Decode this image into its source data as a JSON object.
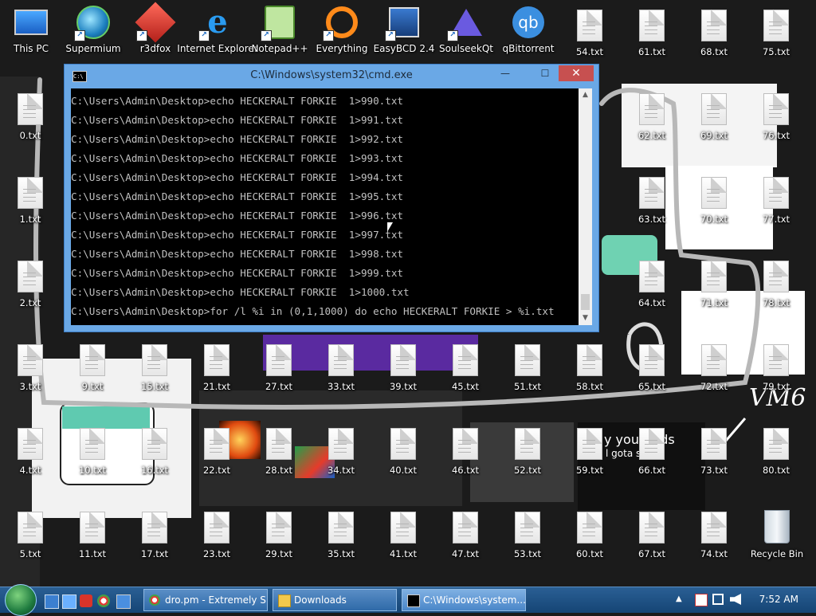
{
  "desktop": {
    "app_icons": [
      {
        "label": "This PC",
        "icon": "monitor-icon"
      },
      {
        "label": "Supermium",
        "icon": "globe-icon"
      },
      {
        "label": "r3dfox",
        "icon": "fox-icon"
      },
      {
        "label": "Internet Explorer",
        "icon": "ie-icon"
      },
      {
        "label": "Notepad++",
        "icon": "notepad-icon"
      },
      {
        "label": "Everything",
        "icon": "search-ring-icon"
      },
      {
        "label": "EasyBCD 2.4",
        "icon": "bcd-icon"
      },
      {
        "label": "SoulseekQt",
        "icon": "bird-icon"
      },
      {
        "label": "qBittorrent",
        "icon": "qb-icon"
      }
    ],
    "txt_files": [
      "0.txt",
      "1.txt",
      "2.txt",
      "3.txt",
      "4.txt",
      "5.txt",
      "9.txt",
      "10.txt",
      "11.txt",
      "15.txt",
      "16.txt",
      "17.txt",
      "21.txt",
      "22.txt",
      "23.txt",
      "27.txt",
      "28.txt",
      "29.txt",
      "33.txt",
      "34.txt",
      "35.txt",
      "39.txt",
      "40.txt",
      "41.txt",
      "45.txt",
      "46.txt",
      "47.txt",
      "51.txt",
      "52.txt",
      "53.txt",
      "54.txt",
      "58.txt",
      "59.txt",
      "60.txt",
      "61.txt",
      "62.txt",
      "63.txt",
      "64.txt",
      "65.txt",
      "66.txt",
      "67.txt",
      "68.txt",
      "69.txt",
      "70.txt",
      "71.txt",
      "72.txt",
      "73.txt",
      "74.txt",
      "75.txt",
      "76.txt",
      "77.txt",
      "78.txt",
      "79.txt",
      "80.txt"
    ],
    "recycle_bin": "Recycle Bin",
    "wallpaper_text": {
      "vm6": "VM6",
      "banner": "y you, ards",
      "subtitle": "l gota sup"
    }
  },
  "cmd_window": {
    "title": "C:\\Windows\\system32\\cmd.exe",
    "app_icon_text": "C:\\",
    "minimize": "—",
    "maximize": "☐",
    "close": "✕",
    "lines": [
      "C:\\Users\\Admin\\Desktop>echo HECKERALT FORKIE  1>990.txt",
      "C:\\Users\\Admin\\Desktop>echo HECKERALT FORKIE  1>991.txt",
      "C:\\Users\\Admin\\Desktop>echo HECKERALT FORKIE  1>992.txt",
      "C:\\Users\\Admin\\Desktop>echo HECKERALT FORKIE  1>993.txt",
      "C:\\Users\\Admin\\Desktop>echo HECKERALT FORKIE  1>994.txt",
      "C:\\Users\\Admin\\Desktop>echo HECKERALT FORKIE  1>995.txt",
      "C:\\Users\\Admin\\Desktop>echo HECKERALT FORKIE  1>996.txt",
      "C:\\Users\\Admin\\Desktop>echo HECKERALT FORKIE  1>997.txt",
      "C:\\Users\\Admin\\Desktop>echo HECKERALT FORKIE  1>998.txt",
      "C:\\Users\\Admin\\Desktop>echo HECKERALT FORKIE  1>999.txt",
      "C:\\Users\\Admin\\Desktop>echo HECKERALT FORKIE  1>1000.txt",
      "C:\\Users\\Admin\\Desktop>for /l %i in (0,1,1000) do echo HECKERALT FORKIE > %i.txt"
    ]
  },
  "taskbar": {
    "buttons": [
      {
        "label": "dro.pm - Extremely S...",
        "icon": "browser-icon"
      },
      {
        "label": "Downloads",
        "icon": "folder-icon"
      },
      {
        "label": "C:\\Windows\\system...",
        "icon": "cmd-icon",
        "active": true
      }
    ],
    "clock": "7:52 AM"
  },
  "colors": {
    "titlebar": "#6aa8e6",
    "close": "#c75050",
    "taskbar": "#1f5488"
  }
}
